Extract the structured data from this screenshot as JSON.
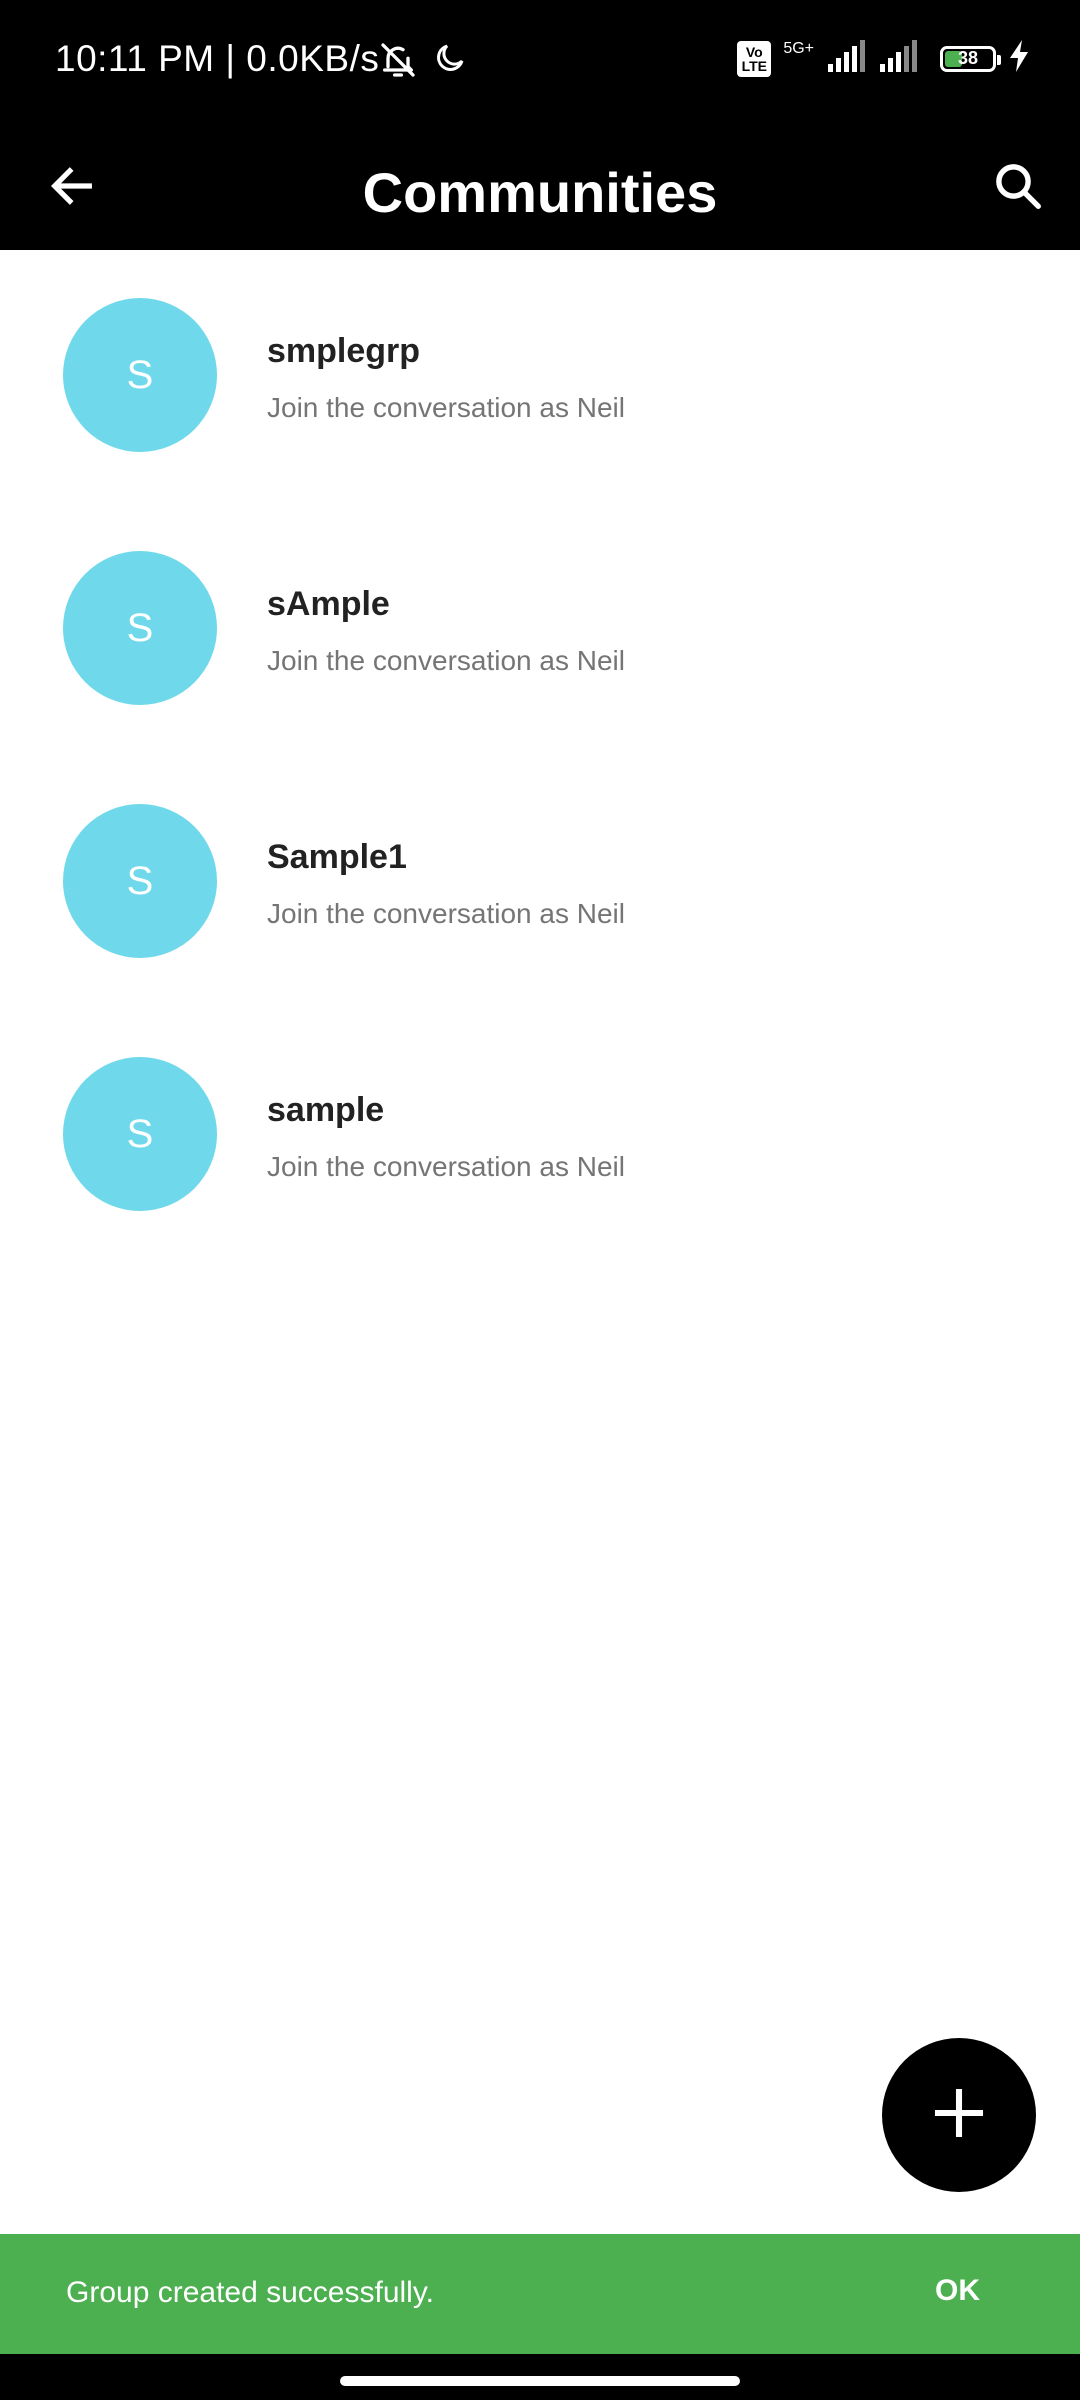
{
  "status_bar": {
    "time": "10:11 PM | 0.0KB/s",
    "network": "5G+",
    "volte": "Vo LTE",
    "battery": "38",
    "battery_level_percent": 38,
    "icons": [
      "mute-bell-icon",
      "moon-icon",
      "signal-icon",
      "signal-icon",
      "battery-icon",
      "charging-icon"
    ]
  },
  "app_bar": {
    "title": "Communities",
    "back_icon": "back-arrow-icon",
    "search_icon": "search-icon"
  },
  "communities": [
    {
      "initial": "S",
      "name": "smplegrp",
      "subtitle": "Join the conversation as Neil"
    },
    {
      "initial": "S",
      "name": "sAmple",
      "subtitle": "Join the conversation as Neil"
    },
    {
      "initial": "S",
      "name": "Sample1",
      "subtitle": "Join the conversation as Neil"
    },
    {
      "initial": "S",
      "name": "sample",
      "subtitle": "Join the conversation as Neil"
    }
  ],
  "fab": {
    "icon": "plus-icon"
  },
  "snackbar": {
    "message": "Group created successfully.",
    "action": "OK"
  },
  "colors": {
    "bar_background": "#000000",
    "avatar": "#6FD9EB",
    "snackbar": "#4CAF50"
  }
}
